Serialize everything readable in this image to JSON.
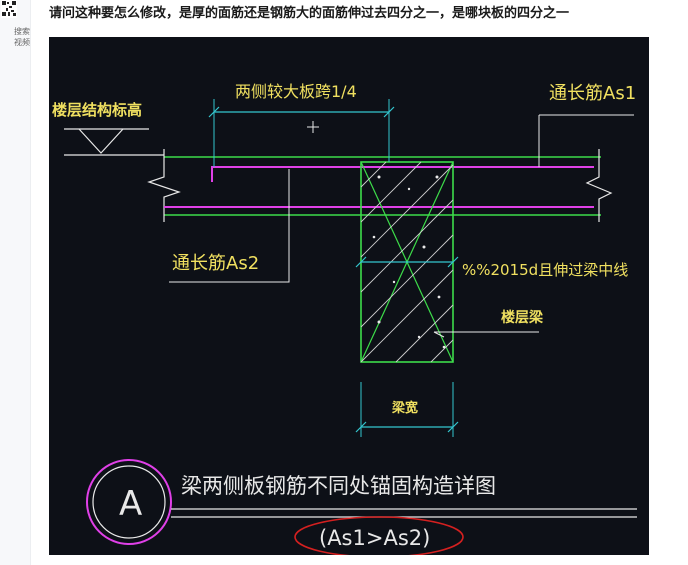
{
  "sidebar": {
    "label_1": "搜索",
    "label_2": "视频"
  },
  "question": {
    "text": "请问这种要怎么修改，是厚的面筋还是钢筋大的面筋伸过去四分之一，是哪块板的四分之一"
  },
  "drawing": {
    "floor_elevation_label": "楼层结构标高",
    "slab_span_label": "两侧较大板跨1/4",
    "top_rebar_label": "通长筋As1",
    "bottom_rebar_label": "通长筋As2",
    "anchor_note": "%%2015d且伸过梁中线",
    "beam_label": "楼层梁",
    "beam_width_label": "梁宽",
    "detail_marker": "A",
    "detail_title": "梁两侧板钢筋不同处锚固构造详图",
    "condition_note": "(As1>As2)"
  },
  "colors": {
    "cad_background": "#0d1017",
    "green_line": "#3ddc4a",
    "magenta_line": "#e040e8",
    "cyan_dimension": "#34c6cf",
    "white_line": "#e8e8e8",
    "yellow_text": "#f0e060",
    "red_circle": "#d42020"
  }
}
